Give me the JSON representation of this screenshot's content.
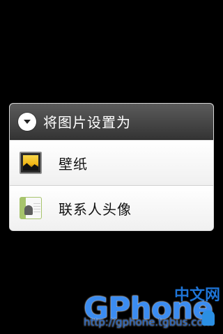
{
  "dialog": {
    "title": "将图片设置为",
    "items": [
      {
        "label": "壁纸",
        "icon": "wallpaper-icon"
      },
      {
        "label": "联系人头像",
        "icon": "contact-photo-icon"
      }
    ]
  },
  "watermark": {
    "brand": "GPhone",
    "chinese": "中文网",
    "url": "http://gphone.tgbus.com"
  }
}
